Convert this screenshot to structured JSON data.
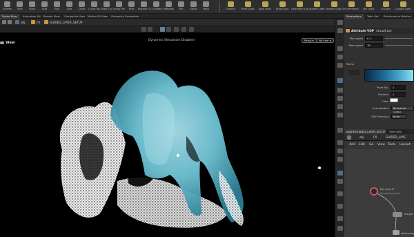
{
  "shelf": {
    "tools": [
      "Sphere",
      "Tube",
      "Torus",
      "Grid",
      "Null",
      "Line",
      "Circle",
      "Curve Bezier",
      "Draw Curve",
      "Spray Paint",
      "Font",
      "Platonic Solids",
      "L-System",
      "Metaball",
      "File",
      "Spiral",
      "Helix"
    ],
    "lights": [
      "Camera",
      "Point Light",
      "Spot Light",
      "Area Light",
      "Geometry Light",
      "Volume Light",
      "Distant Light",
      "Environment Light",
      "Sky Light",
      "GI Light",
      "Caustic Light"
    ]
  },
  "pane_tabs": [
    "Scene View",
    "Animation Editor",
    "Render View",
    "Composite View",
    "Motion FX View",
    "Geometry Spreadsheet"
  ],
  "right_tabs": [
    "Parameters",
    "Take List",
    "Performance Monitor"
  ],
  "path": {
    "obj": "obj",
    "fx": "FX",
    "node": "GUIDED_LAYER_SETUP"
  },
  "viewport": {
    "title": "View",
    "status": "Dynamics Simulation Disabled",
    "persp": "Persp",
    "cam": "No cam"
  },
  "params": {
    "node_type": "Attribute VOP",
    "node_name": "visualize",
    "min_speed_label": "Min speed",
    "min_speed": "0.1",
    "max_speed_label": "Max speed",
    "max_speed": "10",
    "ramp_label": "Ramp",
    "point_no_label": "Point No.",
    "point_no": "1",
    "position_label": "Position",
    "position": "1",
    "color_label": "Color",
    "interp_label": "Interpolation",
    "interp": "Monotone Cubic",
    "vex_label": "VEX Precision",
    "vex": "Auto"
  },
  "network": {
    "tab1": "obj/FX/GUIDED_LAYER_SETUP",
    "tab2": "Tree View",
    "path_obj": "obj",
    "path_fx": "FX",
    "path_node": "GUIDED_LAYE",
    "menu": [
      "Add",
      "Edit",
      "Go",
      "View",
      "Tools",
      "Layout"
    ],
    "node1": "flip_import1",
    "node1_sub": "Dynamics_cache",
    "node2": "merge1",
    "node3": "attribwrangle1"
  },
  "colors": {
    "accent": "#4e6f8c",
    "fluid": "#6fc3d4",
    "ramp_end": "#8fe0ef"
  }
}
